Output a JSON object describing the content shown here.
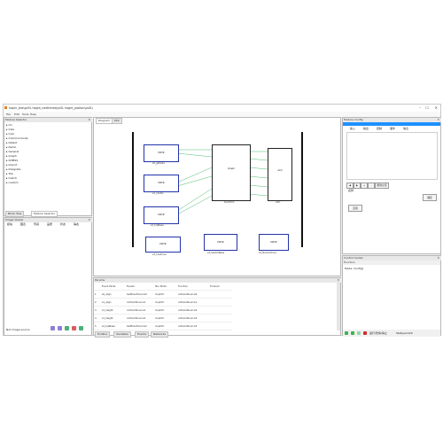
{
  "window": {
    "title": "hapnr_box\\pvSL hagnt_nexttimes\\pvSL hagnt_postsin\\pvSL\\"
  },
  "menu": [
    "File",
    "Edit",
    "Tools",
    "Help"
  ],
  "module_selector": {
    "title": "Module Selector",
    "items": [
      "Ch",
      "Cide",
      "Com",
      "Commonmode",
      "Detect",
      "Demo",
      "General",
      "Graph",
      "AHMSS",
      "Import",
      "Integrate",
      "Tile",
      "match",
      "custom"
    ],
    "tabs": [
      "Block Tree",
      "Module Selector"
    ]
  },
  "image_viewer": {
    "title": "Image Viewer",
    "toolbar": [
      "模块",
      "图表",
      "传感",
      "品质",
      "状态",
      "静态"
    ],
    "status": "Not image source"
  },
  "editor": {
    "tabs": [
      "Diagram",
      "Plot"
    ],
    "blocks": [
      {
        "name": "DRVR",
        "label": "s0_glbSide"
      },
      {
        "name": "DRVR",
        "label": "s1_center"
      },
      {
        "name": "DRVR",
        "label": "s2_topBase"
      },
      {
        "name": "DRVR",
        "label": "s3_lineDrive"
      },
      {
        "name": "DRVR",
        "label": "s4_SwitchBase"
      },
      {
        "name": "Graph",
        "label": "DomFiml"
      },
      {
        "name": "DRVR",
        "label": "s5_BorderDrive"
      },
      {
        "name": "ACC",
        "label": "ACC"
      }
    ]
  },
  "params": {
    "title": "Params",
    "columns": [
      "",
      "Event Mode",
      "Events",
      "Run Mode",
      "Function",
      "Forward"
    ],
    "rows": [
      [
        "1",
        "s0_align",
        "GetEventSource0",
        "loopCtrl",
        "onEventSource0",
        ""
      ],
      [
        "2",
        "s1_align",
        "onEventSource1",
        "loopCtrl",
        "onEventSource1",
        ""
      ],
      [
        "3",
        "s1_height",
        "onEventSource1",
        "loopCtrl",
        "onEventSource2",
        ""
      ],
      [
        "4",
        "s1_height",
        "onEventSource2",
        "loopCtrl",
        "onEventSource3",
        ""
      ],
      [
        "5",
        "s2_topBase",
        "GetEventSource2",
        "loopCtrl",
        "onEventSource3",
        ""
      ]
    ],
    "tabs": [
      "Endline",
      "Variables",
      "Events",
      "Networks"
    ]
  },
  "module_config": {
    "title": "Module Config",
    "tabs": [
      "输入",
      "输出",
      "控制",
      "事件",
      "信息"
    ],
    "label_text": "名称",
    "apply_label": "应用",
    "ok_label": "确定",
    "small_buttons": [
      "◀",
      "▶",
      "+",
      "–",
      "删除全部"
    ]
  },
  "control_center": {
    "title": "Control Center",
    "sub_title": "Function",
    "log_line": "Mode: Config]",
    "status_label": "运行/暂停/停止 ",
    "status_value": "Stat/ped:0/0"
  },
  "colors": {
    "block_border": "#2233aa",
    "port_text": "#22aa44",
    "accent": "#1e90ff"
  }
}
